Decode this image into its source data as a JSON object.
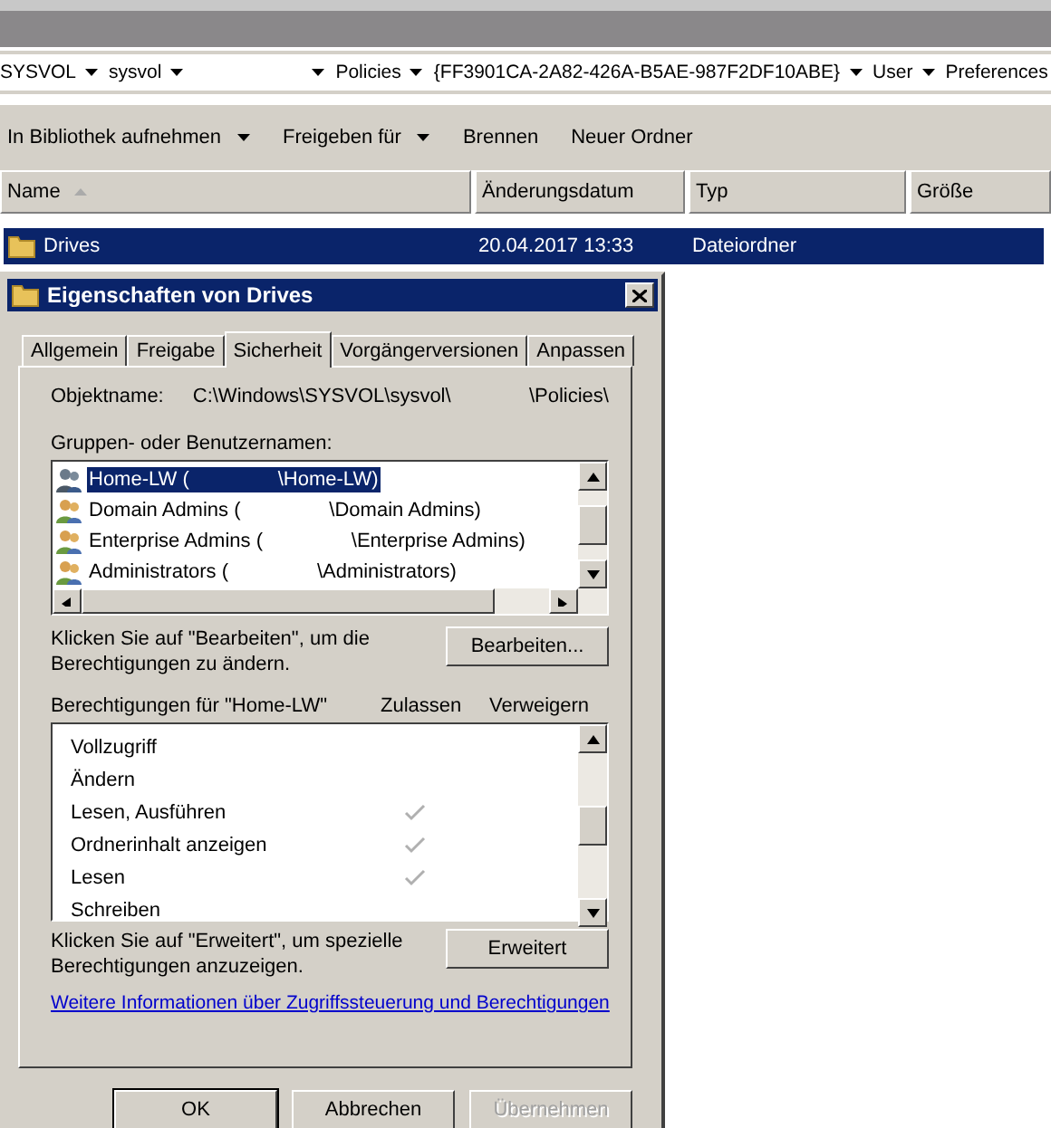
{
  "breadcrumb": [
    {
      "kind": "text",
      "label": "SYSVOL"
    },
    {
      "kind": "text",
      "label": "sysvol"
    },
    {
      "kind": "blank"
    },
    {
      "kind": "text",
      "label": "Policies"
    },
    {
      "kind": "text",
      "label": "{FF3901CA-2A82-426A-B5AE-987F2DF10ABE}"
    },
    {
      "kind": "text",
      "label": "User"
    },
    {
      "kind": "text",
      "label": "Preferences"
    }
  ],
  "toolbar": [
    {
      "label": "In Bibliothek aufnehmen",
      "has_menu": true
    },
    {
      "label": "Freigeben für",
      "has_menu": true
    },
    {
      "label": "Brennen",
      "has_menu": false
    },
    {
      "label": "Neuer Ordner",
      "has_menu": false
    }
  ],
  "columns": [
    {
      "label": "Name",
      "sorted": true
    },
    {
      "label": "Änderungsdatum",
      "sorted": false
    },
    {
      "label": "Typ",
      "sorted": false
    },
    {
      "label": "Größe",
      "sorted": false
    }
  ],
  "rows": [
    {
      "name": "Drives",
      "date": "20.04.2017 13:33",
      "type": "Dateiordner",
      "selected": true
    }
  ],
  "dialog": {
    "title": "Eigenschaften von Drives",
    "tabs": [
      {
        "label": "Allgemein",
        "selected": false
      },
      {
        "label": "Freigabe",
        "selected": false
      },
      {
        "label": "Sicherheit",
        "selected": true
      },
      {
        "label": "Vorgängerversionen",
        "selected": false
      },
      {
        "label": "Anpassen",
        "selected": false
      }
    ],
    "object_label": "Objektname:",
    "object_path": "C:\\Windows\\SYSVOL\\sysvol\\",
    "object_path_end": "\\Policies\\",
    "groups_label": "Gruppen- oder Benutzernamen:",
    "groups": [
      {
        "name": "Home-LW (",
        "domain_suffix": "\\Home-LW)",
        "selected": true
      },
      {
        "name": "Domain Admins (",
        "domain_suffix": "\\Domain Admins)",
        "selected": false
      },
      {
        "name": "Enterprise Admins (",
        "domain_suffix": "\\Enterprise Admins)",
        "selected": false
      },
      {
        "name": "Administrators (",
        "domain_suffix": "\\Administrators)",
        "selected": false
      }
    ],
    "edit_hint": "Klicken Sie auf \"Bearbeiten\", um die Berechtigungen zu ändern.",
    "edit_button": "Bearbeiten...",
    "permissions_label": "Berechtigungen für \"Home-LW\"",
    "allow_label": "Zulassen",
    "deny_label": "Verweigern",
    "permissions": [
      {
        "name": "Vollzugriff",
        "allow": false
      },
      {
        "name": "Ändern",
        "allow": false
      },
      {
        "name": "Lesen, Ausführen",
        "allow": true
      },
      {
        "name": "Ordnerinhalt anzeigen",
        "allow": true
      },
      {
        "name": "Lesen",
        "allow": true
      },
      {
        "name": "Schreiben",
        "allow": false
      }
    ],
    "advanced_hint": "Klicken Sie auf \"Erweitert\", um spezielle Berechtigungen anzuzeigen.",
    "advanced_button": "Erweitert",
    "link": "Weitere Informationen über Zugriffssteuerung und Berechtigungen",
    "buttons": [
      {
        "label": "OK",
        "default": true,
        "disabled": false
      },
      {
        "label": "Abbrechen",
        "default": false,
        "disabled": false
      },
      {
        "label": "Übernehmen",
        "default": false,
        "disabled": true
      }
    ]
  }
}
